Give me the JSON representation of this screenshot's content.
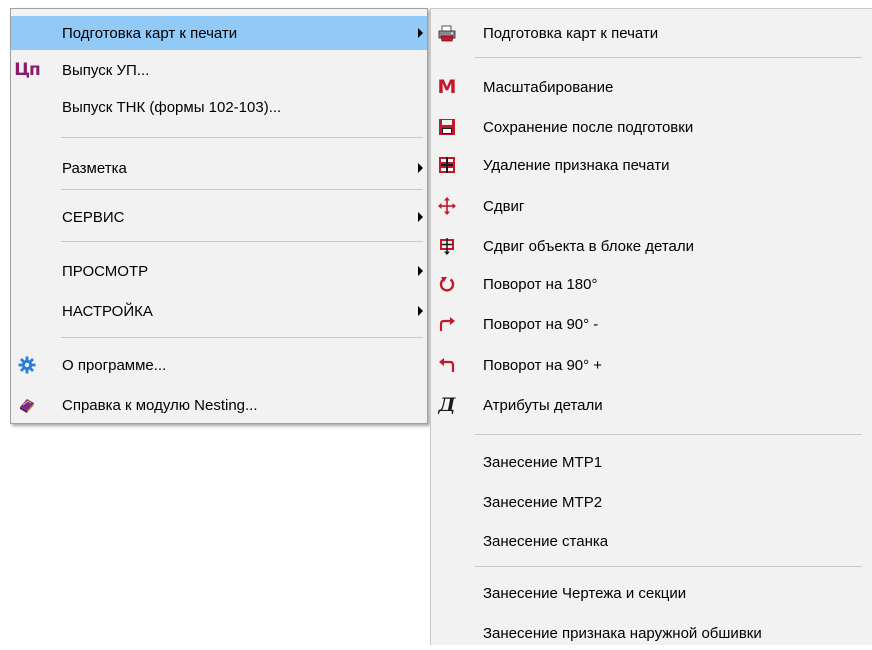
{
  "main_menu": {
    "items": [
      {
        "label": "Подготовка карт к печати"
      },
      {
        "label": "Выпуск УП..."
      },
      {
        "label": "Выпуск ТНК (формы 102-103)..."
      },
      {
        "label": "Разметка"
      },
      {
        "label": "СЕРВИС"
      },
      {
        "label": "ПРОСМОТР"
      },
      {
        "label": "НАСТРОЙКА"
      },
      {
        "label": "О программе..."
      },
      {
        "label": "Справка к модулю Nesting..."
      }
    ],
    "icons": {
      "up_glyph": "Цп"
    }
  },
  "sub_menu": {
    "items": [
      {
        "label": "Подготовка карт к печати"
      },
      {
        "label": "Масштабирование"
      },
      {
        "label": "Сохранение после подготовки"
      },
      {
        "label": "Удаление признака печати"
      },
      {
        "label": "Сдвиг"
      },
      {
        "label": "Сдвиг объекта в блоке детали"
      },
      {
        "label": "Поворот на 180°"
      },
      {
        "label": "Поворот на 90° -"
      },
      {
        "label": "Поворот на 90° +"
      },
      {
        "label": "Атрибуты детали"
      },
      {
        "label": "Занесение МТР1"
      },
      {
        "label": "Занесение МТР2"
      },
      {
        "label": "Занесение станка"
      },
      {
        "label": "Занесение Чертежа и секции"
      },
      {
        "label": "Занесение признака наружной обшивки"
      }
    ],
    "icons": {
      "scale_glyph": "M",
      "attributes_glyph": "Д"
    }
  },
  "colors": {
    "menu_background": "#f2f2f2",
    "highlight": "#91c9f7",
    "separator": "#c9c9c9",
    "icon_red": "#c0192b",
    "icon_purple": "#8b1c6a",
    "icon_blue": "#2a7fd4"
  }
}
